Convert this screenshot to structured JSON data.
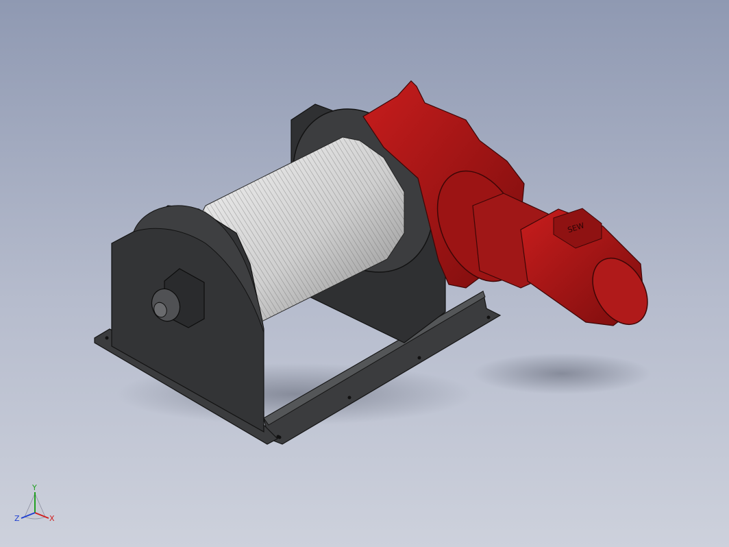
{
  "app": {
    "title": ""
  },
  "model": {
    "name": "",
    "colors": {
      "background_top": "#8f99b2",
      "background_bottom": "#cdd1dc",
      "frame": "#3a3b3d",
      "frame_dark": "#232425",
      "drum_rope": "#d7d7d7",
      "gear_motor": "#a21515",
      "gear_motor_dark": "#6e0c0c"
    },
    "motor_label": "SEW"
  },
  "triad": {
    "x_label": "X",
    "y_label": "Y",
    "z_label": "Z",
    "x_color": "#d02020",
    "y_color": "#20a020",
    "z_color": "#2040d0"
  }
}
